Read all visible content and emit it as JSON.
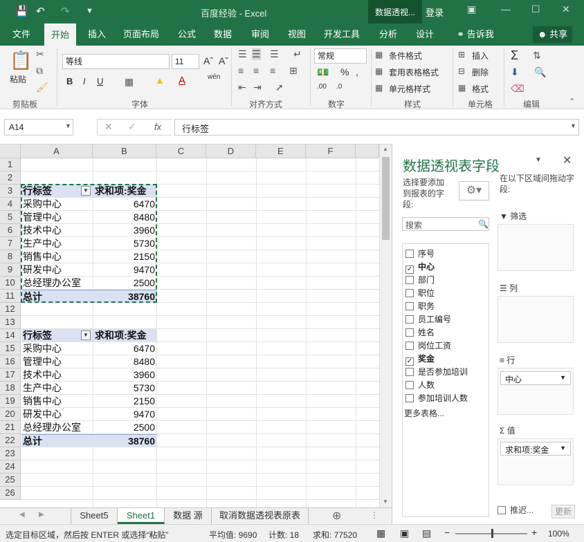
{
  "titlebar": {
    "title": "百度经验 - Excel",
    "context_title": "数据透视...",
    "login": "登录"
  },
  "tabs": [
    "文件",
    "开始",
    "插入",
    "页面布局",
    "公式",
    "数据",
    "审阅",
    "视图",
    "开发工具",
    "分析",
    "设计",
    "告诉我"
  ],
  "share_label": "共享",
  "ribbon": {
    "paste": "粘贴",
    "font_name": "等线",
    "font_size": "11",
    "number_format": "常规",
    "conditional_format": "条件格式",
    "table_format": "套用表格格式",
    "cell_style": "单元格样式",
    "insert": "插入",
    "delete": "删除",
    "format": "格式",
    "groups": [
      "剪贴板",
      "字体",
      "对齐方式",
      "数字",
      "样式",
      "单元格",
      "编辑"
    ]
  },
  "formula_bar": {
    "name_box": "A14",
    "formula": "行标签"
  },
  "columns": [
    "A",
    "B",
    "C",
    "D",
    "E",
    "F"
  ],
  "rows": [
    "1",
    "2",
    "3",
    "4",
    "5",
    "6",
    "7",
    "8",
    "9",
    "10",
    "11",
    "12",
    "13",
    "14",
    "15",
    "16",
    "17",
    "18",
    "19",
    "20",
    "21",
    "22",
    "23",
    "24",
    "25",
    "26"
  ],
  "pivot1": {
    "header_label": "行标签",
    "header_value": "求和项:奖金",
    "rows": [
      {
        "label": "采购中心",
        "value": "6470"
      },
      {
        "label": "管理中心",
        "value": "8480"
      },
      {
        "label": "技术中心",
        "value": "3960"
      },
      {
        "label": "生产中心",
        "value": "5730"
      },
      {
        "label": "销售中心",
        "value": "2150"
      },
      {
        "label": "研发中心",
        "value": "9470"
      },
      {
        "label": "总经理办公室",
        "value": "2500"
      }
    ],
    "total_label": "总计",
    "total_value": "38760"
  },
  "pivot2": {
    "header_label": "行标签",
    "header_value": "求和项:奖金",
    "rows": [
      {
        "label": "采购中心",
        "value": "6470"
      },
      {
        "label": "管理中心",
        "value": "8480"
      },
      {
        "label": "技术中心",
        "value": "3960"
      },
      {
        "label": "生产中心",
        "value": "5730"
      },
      {
        "label": "销售中心",
        "value": "2150"
      },
      {
        "label": "研发中心",
        "value": "9470"
      },
      {
        "label": "总经理办公室",
        "value": "2500"
      }
    ],
    "total_label": "总计",
    "total_value": "38760"
  },
  "sheets": [
    "Sheet5",
    "Sheet1",
    "数据 源",
    "取消数据透视表原表"
  ],
  "active_sheet": "Sheet1",
  "status": {
    "message": "选定目标区域，然后按 ENTER 或选择“粘贴”",
    "average": "平均值: 9690",
    "count": "计数: 18",
    "sum": "求和: 77520",
    "zoom": "100%"
  },
  "pivot_pane": {
    "title": "数据透视表字段",
    "choose_label": "选择要添加到报表的字段:",
    "drag_label": "在以下区域间拖动字段:",
    "search_placeholder": "搜索",
    "fields": [
      {
        "name": "序号",
        "checked": false
      },
      {
        "name": "中心",
        "checked": true
      },
      {
        "name": "部门",
        "checked": false
      },
      {
        "name": "职位",
        "checked": false
      },
      {
        "name": "职务",
        "checked": false
      },
      {
        "name": "员工编号",
        "checked": false
      },
      {
        "name": "姓名",
        "checked": false
      },
      {
        "name": "岗位工资",
        "checked": false
      },
      {
        "name": "奖金",
        "checked": true
      },
      {
        "name": "是否参加培训",
        "checked": false
      },
      {
        "name": "人数",
        "checked": false
      },
      {
        "name": "参加培训人数",
        "checked": false
      }
    ],
    "more_tables": "更多表格...",
    "areas": {
      "filter": "筛选",
      "columns": "列",
      "rows": "行",
      "values": "值"
    },
    "row_item": "中心",
    "value_item": "求和项:奖金",
    "defer": "推迟...",
    "update": "更新"
  },
  "colors": {
    "accent": "#217346",
    "pivot_header": "#d9e1f2"
  }
}
